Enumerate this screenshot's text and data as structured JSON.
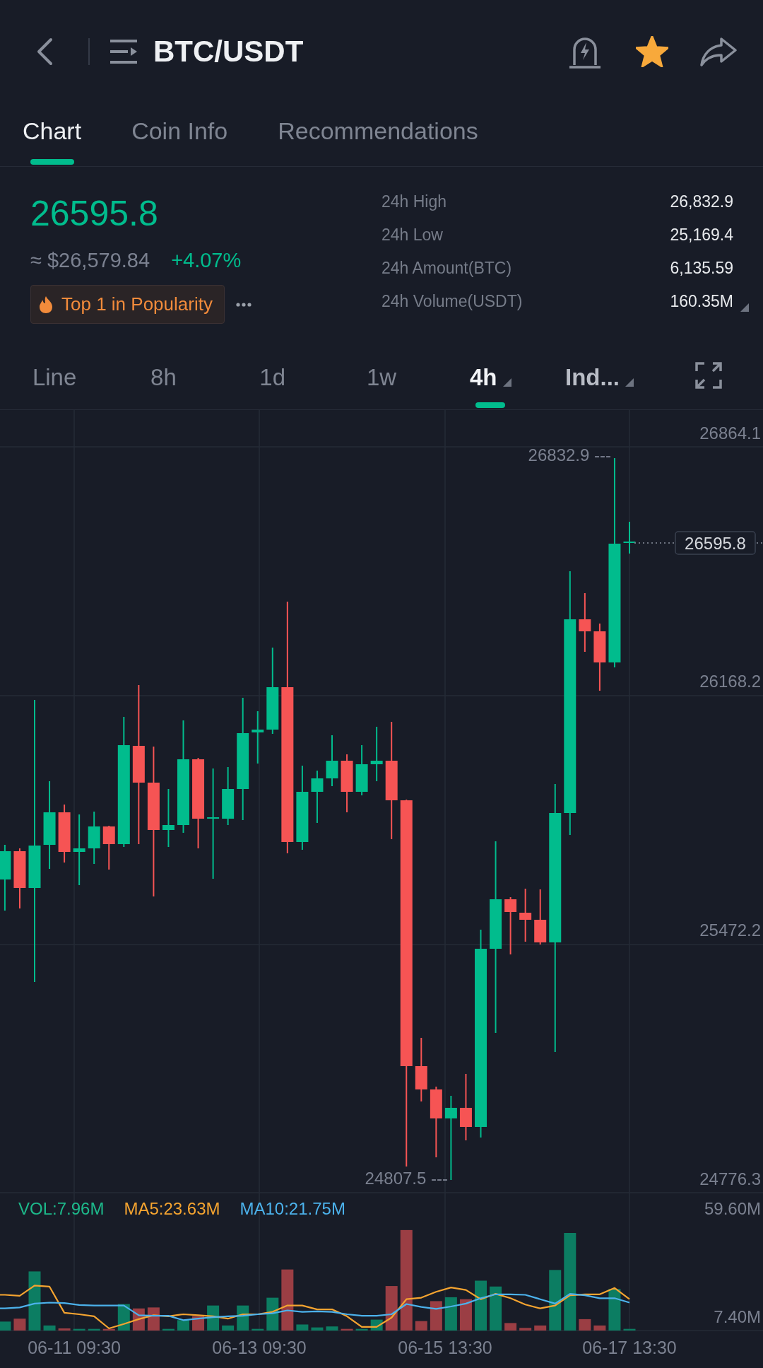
{
  "header": {
    "title": "BTC/USDT",
    "favorite": true
  },
  "tabs": [
    {
      "label": "Chart",
      "selected": true
    },
    {
      "label": "Coin Info",
      "selected": false
    },
    {
      "label": "Recommendations",
      "selected": false
    }
  ],
  "ticker": {
    "last_price": "26595.8",
    "rising": true,
    "fiat_price": "≈ $26,579.84",
    "change": "+4.07%",
    "badge": "Top 1 in Popularity"
  },
  "stats": [
    {
      "label": "24h High",
      "value": "26,832.9",
      "dropdown": false
    },
    {
      "label": "24h Low",
      "value": "25,169.4",
      "dropdown": false
    },
    {
      "label": "24h Amount(BTC)",
      "value": "6,135.59",
      "dropdown": false
    },
    {
      "label": "24h Volume(USDT)",
      "value": "160.35M",
      "dropdown": true
    }
  ],
  "intervals": [
    {
      "label": "Line",
      "kind": "interval",
      "selected": false,
      "dropdown": false
    },
    {
      "label": "8h",
      "kind": "interval",
      "selected": false,
      "dropdown": false
    },
    {
      "label": "1d",
      "kind": "interval",
      "selected": false,
      "dropdown": false
    },
    {
      "label": "1w",
      "kind": "interval",
      "selected": false,
      "dropdown": false
    },
    {
      "label": "4h",
      "kind": "interval",
      "selected": true,
      "dropdown": true
    },
    {
      "label": "Ind...",
      "kind": "menu",
      "selected": false,
      "dropdown": true
    }
  ],
  "chart": {
    "price_axis": [
      "26864.1",
      "26168.2",
      "25472.2",
      "24776.3"
    ],
    "high_label": "26832.9 ---",
    "low_label": "24807.5 ---",
    "last_price_tag": "26595.8",
    "volume_legend": [
      {
        "label": "VOL:7.96M",
        "color": "#1db98b"
      },
      {
        "label": "MA5:23.63M",
        "color": "#f5a430"
      },
      {
        "label": "MA10:21.75M",
        "color": "#4cb2ec"
      }
    ],
    "volume_axis": [
      "59.60M",
      "7.40M"
    ],
    "time_axis": [
      "06-11 09:30",
      "06-13 09:30",
      "06-15 13:30",
      "06-17 13:30"
    ]
  }
}
